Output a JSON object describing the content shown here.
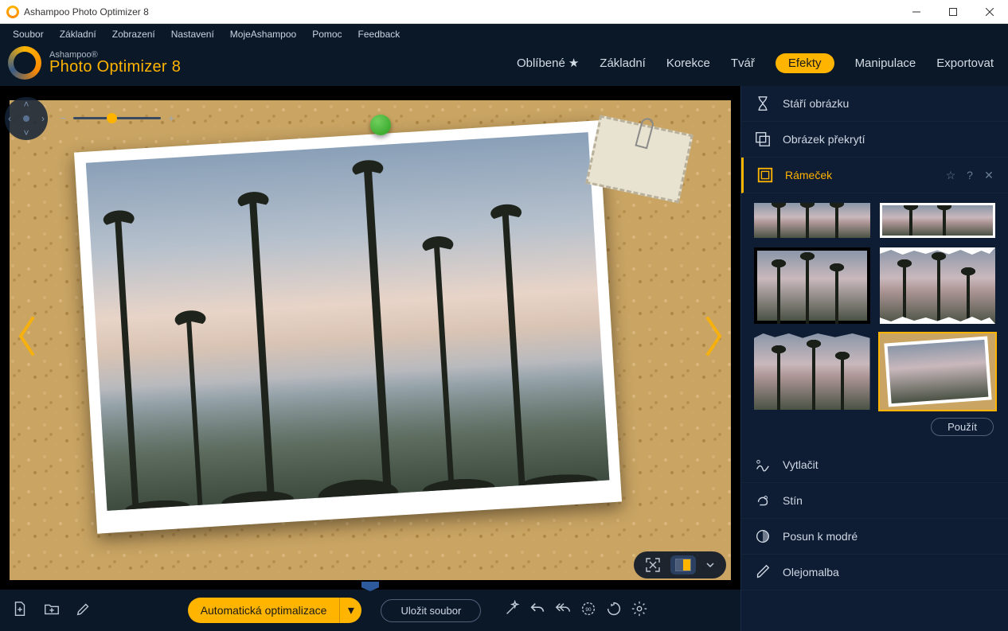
{
  "titlebar": {
    "title": "Ashampoo Photo Optimizer 8"
  },
  "menubar": [
    "Soubor",
    "Základní",
    "Zobrazení",
    "Nastavení",
    "MojeAshampoo",
    "Pomoc",
    "Feedback"
  ],
  "app": {
    "brand": "Ashampoo®",
    "product": "Photo Optimizer 8"
  },
  "tabs": {
    "favorites": "Oblíbené",
    "basic": "Základní",
    "correction": "Korekce",
    "face": "Tvář",
    "effects": "Efekty",
    "manipulate": "Manipulace",
    "export": "Exportovat"
  },
  "effects": {
    "age": "Stáří obrázku",
    "overlay": "Obrázek překrytí",
    "frame": "Rámeček",
    "emboss": "Vytlačit",
    "shadow": "Stín",
    "blueshift": "Posun k modré",
    "oilpaint": "Olejomalba"
  },
  "apply": "Použít",
  "bottom": {
    "auto": "Automatická optimalizace",
    "save": "Uložit soubor"
  }
}
